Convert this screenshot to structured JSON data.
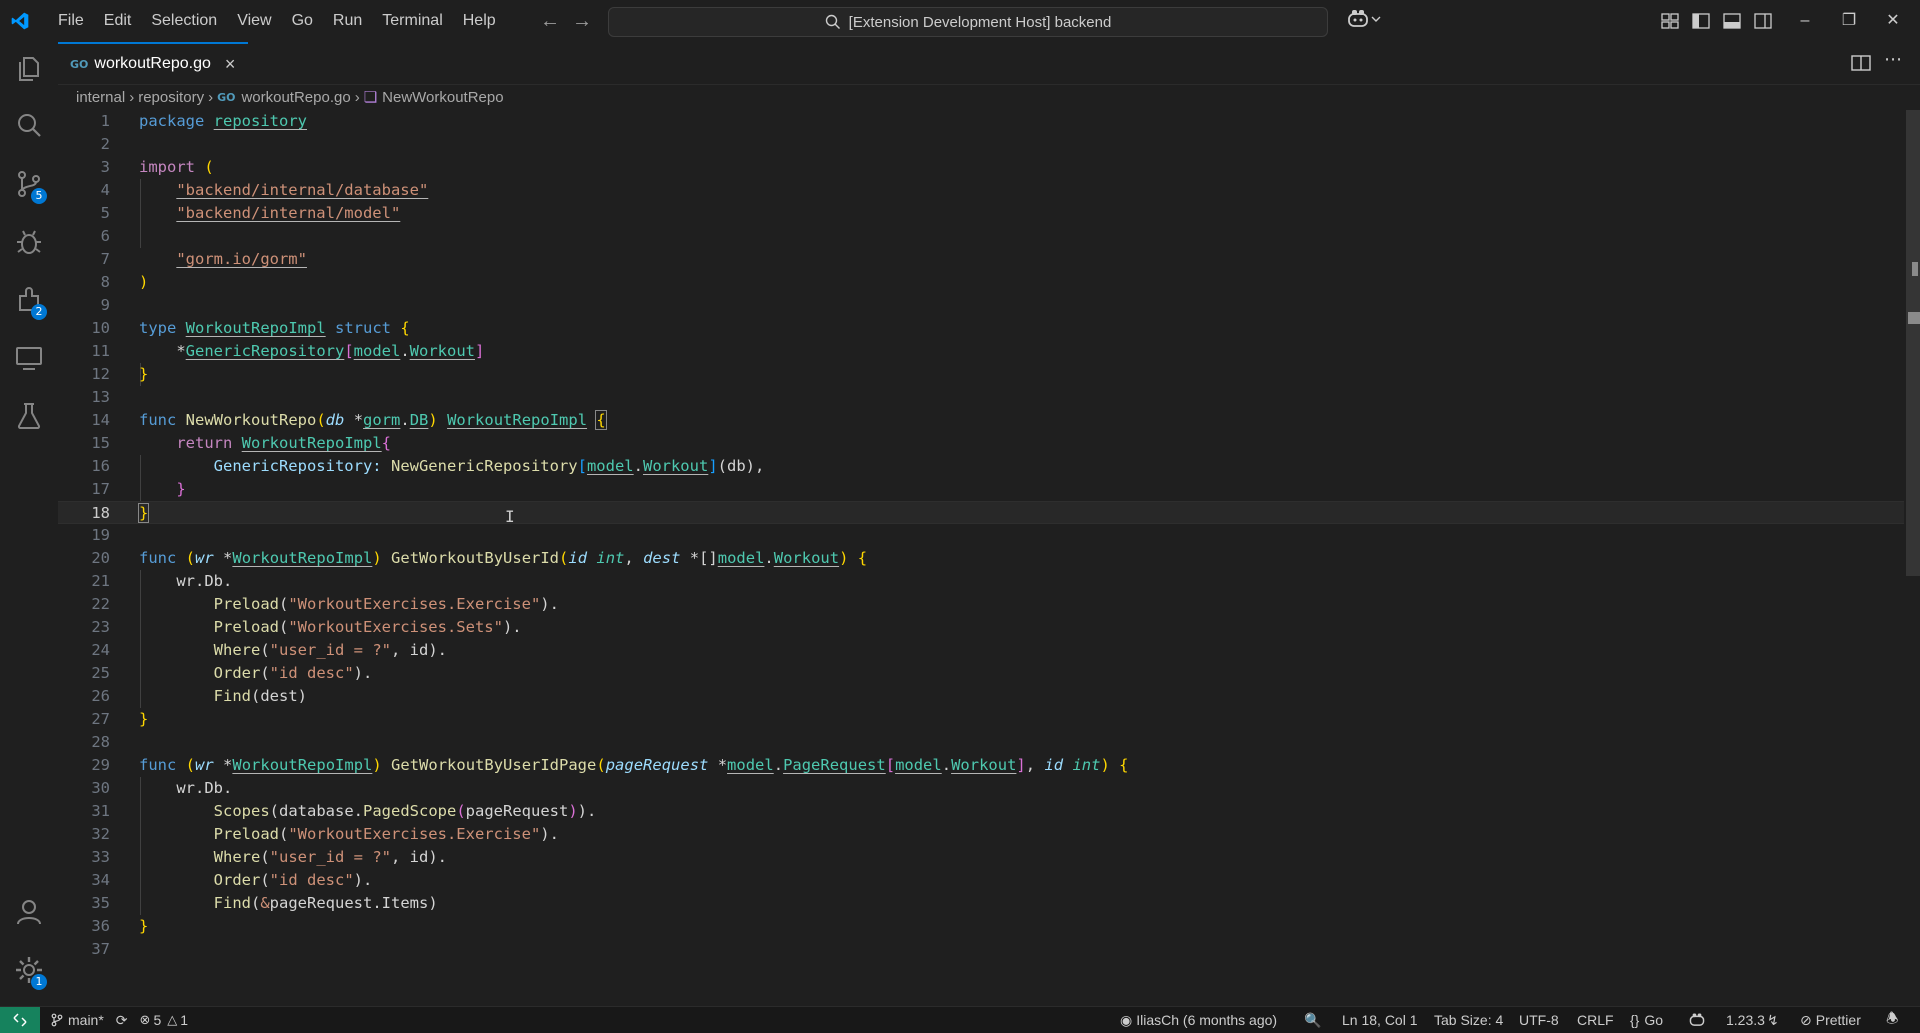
{
  "menu": [
    "File",
    "Edit",
    "Selection",
    "View",
    "Go",
    "Run",
    "Terminal",
    "Help"
  ],
  "command_center": "[Extension Development Host] backend",
  "activity_badges": {
    "source_control": "5",
    "extensions": "2",
    "manage": "1"
  },
  "tab": {
    "label": "workoutRepo.go",
    "lang_badge": "GO"
  },
  "breadcrumb": {
    "p1": "internal",
    "p2": "repository",
    "p3": "workoutRepo.go",
    "p4": "NewWorkoutRepo"
  },
  "line_numbers": [
    "1",
    "2",
    "3",
    "4",
    "5",
    "6",
    "7",
    "8",
    "9",
    "10",
    "11",
    "12",
    "13",
    "14",
    "15",
    "16",
    "17",
    "18",
    "19",
    "20",
    "21",
    "22",
    "23",
    "24",
    "25",
    "26",
    "27",
    "28",
    "29",
    "30",
    "31",
    "32",
    "33",
    "34",
    "35",
    "36",
    "37"
  ],
  "code": {
    "l1": [
      "package",
      "repository"
    ],
    "l3": [
      "import",
      "("
    ],
    "l4": "\"backend/internal/database\"",
    "l5": "\"backend/internal/model\"",
    "l7": "\"gorm.io/gorm\"",
    "l8": ")",
    "l10": [
      "type",
      "WorkoutRepoImpl",
      "struct",
      "{"
    ],
    "l11": [
      "*",
      "GenericRepository",
      "[",
      "model",
      ".",
      "Workout",
      "]"
    ],
    "l12": "}",
    "l14": [
      "func",
      "NewWorkoutRepo",
      "(",
      "db",
      "*",
      "gorm",
      ".",
      "DB",
      ")",
      "WorkoutRepoImpl",
      "{"
    ],
    "l15": [
      "return",
      "WorkoutRepoImpl",
      "{"
    ],
    "l16": [
      "GenericRepository:",
      "NewGenericRepository",
      "[",
      "model",
      ".",
      "Workout",
      "]",
      "(db),"
    ],
    "l17": "}",
    "l18": "}",
    "l20": [
      "func",
      "(",
      "wr",
      "*",
      "WorkoutRepoImpl",
      ")",
      "GetWorkoutByUserId",
      "(",
      "id",
      "int",
      ",",
      "dest",
      "*[]",
      "model",
      ".",
      "Workout",
      ")",
      "{"
    ],
    "l21": "wr.Db.",
    "l22": [
      "Preload",
      "(",
      "\"WorkoutExercises.Exercise\"",
      ")."
    ],
    "l23": [
      "Preload",
      "(",
      "\"WorkoutExercises.Sets\"",
      ")."
    ],
    "l24": [
      "Where",
      "(",
      "\"user_id = ?\"",
      ", id)."
    ],
    "l25": [
      "Order",
      "(",
      "\"id desc\"",
      ")."
    ],
    "l26": [
      "Find",
      "(",
      "dest",
      ")"
    ],
    "l27": "}",
    "l29": [
      "func",
      "(",
      "wr",
      "*",
      "WorkoutRepoImpl",
      ")",
      "GetWorkoutByUserIdPage",
      "(",
      "pageRequest",
      "*",
      "model",
      ".",
      "PageRequest",
      "[",
      "model",
      ".",
      "Workout",
      "]",
      ",",
      "id",
      "int",
      ")",
      "{"
    ],
    "l30": "wr.Db.",
    "l31": [
      "Scopes",
      "(",
      "database",
      ".",
      "PagedScope",
      "(",
      "pageRequest",
      ")",
      ")."
    ],
    "l32": [
      "Preload",
      "(",
      "\"WorkoutExercises.Exercise\"",
      ")."
    ],
    "l33": [
      "Where",
      "(",
      "\"user_id = ?\"",
      ", id)."
    ],
    "l34": [
      "Order",
      "(",
      "\"id desc\"",
      ")."
    ],
    "l35": [
      "Find",
      "(",
      "&",
      "pageRequest.Items",
      ")"
    ],
    "l36": "}"
  },
  "status": {
    "branch": "main*",
    "errors": "5",
    "warnings": "1",
    "blame": "IliasCh (6 months ago)",
    "cursor": "Ln 18, Col 1",
    "tab_size": "Tab Size: 4",
    "encoding": "UTF-8",
    "eol": "CRLF",
    "language": "Go",
    "go_version": "1.23.3",
    "formatter": "Prettier"
  },
  "colors": {
    "accent": "#0078d4",
    "remote": "#16825d",
    "background": "#1f1f1f"
  }
}
